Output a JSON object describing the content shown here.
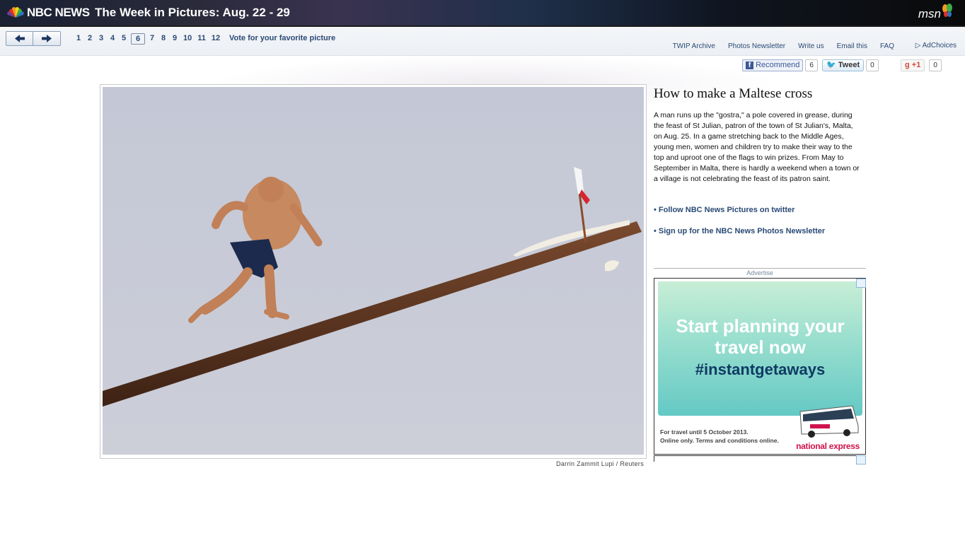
{
  "header": {
    "brand": "NBC NEWS",
    "title": "The Week in Pictures: Aug. 22 - 29",
    "partner": "msn"
  },
  "nav": {
    "pages": [
      "1",
      "2",
      "3",
      "4",
      "5",
      "6",
      "7",
      "8",
      "9",
      "10",
      "11",
      "12"
    ],
    "current_page": "6",
    "vote_label": "Vote for your favorite picture",
    "links": [
      "TWIP Archive",
      "Photos Newsletter",
      "Write us",
      "Email this",
      "FAQ"
    ],
    "adchoices": "AdChoices"
  },
  "social": {
    "fb_label": "Recommend",
    "fb_count": "6",
    "tw_label": "Tweet",
    "tw_count": "0",
    "gp_label": "+1",
    "gp_count": "0"
  },
  "photo": {
    "credit": "Darrin Zammit Lupi / Reuters"
  },
  "article": {
    "headline": "How to make a Maltese cross",
    "caption": "A man runs up the \"gostra,\" a pole covered in grease, during the feast of St Julian, patron of the town of St Julian's, Malta, on Aug. 25. In a game stretching back to the Middle Ages, young men, women and children try to make their way to the top and uproot one of the flags to win prizes. From May to September in Malta, there is hardly a weekend when a town or a village is not celebrating the feast of its patron saint.",
    "follow_link": "• Follow NBC News Pictures on twitter",
    "signup_link": "• Sign up for the NBC News Photos Newsletter"
  },
  "ad": {
    "label": "Advertise",
    "headline": "Start planning your travel now",
    "tag": "#instantgetaways",
    "small_print": "For travel until 5 October 2013.\nOnline only. Terms and conditions online.",
    "brand": "national express"
  }
}
